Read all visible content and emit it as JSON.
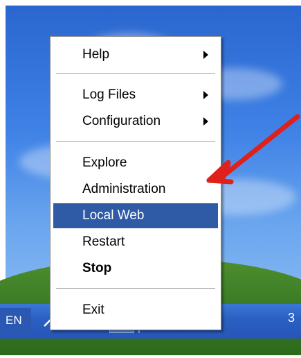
{
  "context_menu": {
    "items": [
      {
        "label": "Help",
        "submenu": true
      },
      {
        "label": "Log Files",
        "submenu": true
      },
      {
        "label": "Configuration",
        "submenu": true
      },
      {
        "label": "Explore"
      },
      {
        "label": "Administration"
      },
      {
        "label": "Local Web",
        "highlighted": true
      },
      {
        "label": "Restart"
      },
      {
        "label": "Stop",
        "bold": true
      },
      {
        "label": "Exit"
      }
    ]
  },
  "taskbar": {
    "language": "EN",
    "clock_fragment": "3",
    "tray_icons": [
      "microphone-icon",
      "keyboard-icon",
      "pen-tablet-icon",
      "server-tray-icon",
      "refresh-circle-icon",
      "e-letter-icon",
      "gear-icon"
    ]
  },
  "colors": {
    "highlight": "#2f5aa6",
    "annotation_arrow": "#e0201a",
    "taskbar": "#2a5fc2"
  }
}
